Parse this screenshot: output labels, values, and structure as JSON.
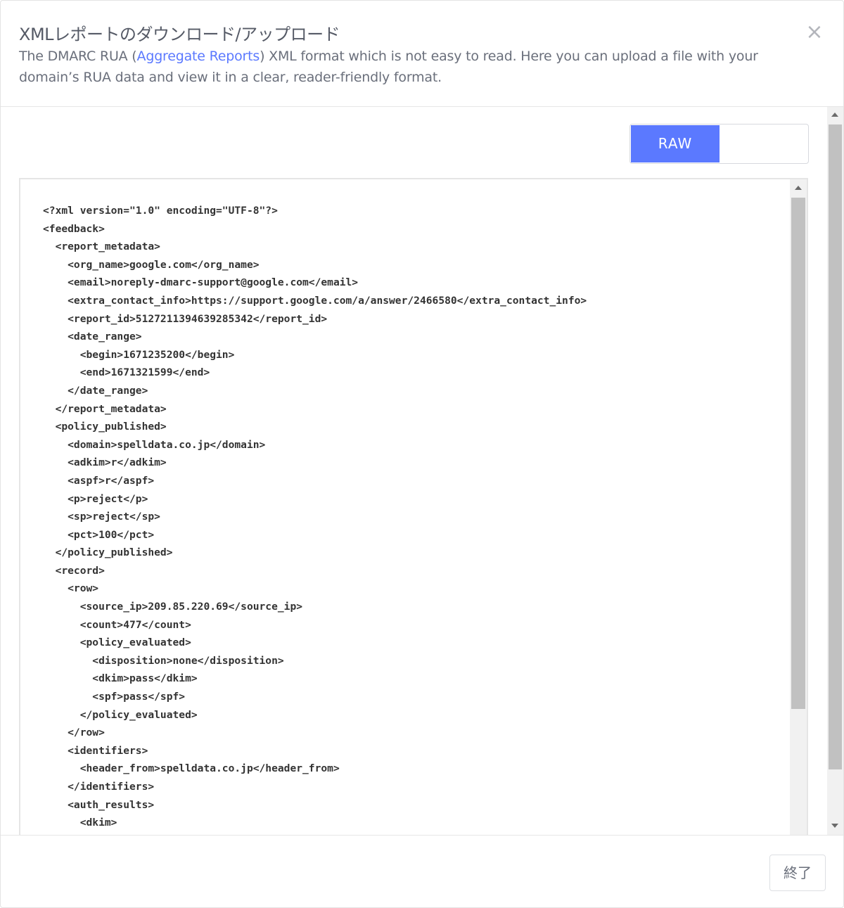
{
  "modal": {
    "title": "XMLレポートのダウンロード/アップロード",
    "close_symbol": "×",
    "description": {
      "before": "The DMARC RUA (",
      "link": "Aggregate Reports",
      "after": ") XML format which is not easy to read. Here you can upload a file with your domain’s RUA data and view it in a clear, reader-friendly format."
    }
  },
  "toggle": {
    "raw_label": "RAW",
    "other_label": ""
  },
  "xml": {
    "lines": [
      "<?xml version=\"1.0\" encoding=\"UTF-8\"?>",
      "<feedback>",
      "  <report_metadata>",
      "    <org_name>google.com</org_name>",
      "    <email>noreply-dmarc-support@google.com</email>",
      "    <extra_contact_info>https://support.google.com/a/answer/2466580</extra_contact_info>",
      "    <report_id>5127211394639285342</report_id>",
      "    <date_range>",
      "      <begin>1671235200</begin>",
      "      <end>1671321599</end>",
      "    </date_range>",
      "  </report_metadata>",
      "  <policy_published>",
      "    <domain>spelldata.co.jp</domain>",
      "    <adkim>r</adkim>",
      "    <aspf>r</aspf>",
      "    <p>reject</p>",
      "    <sp>reject</sp>",
      "    <pct>100</pct>",
      "  </policy_published>",
      "  <record>",
      "    <row>",
      "      <source_ip>209.85.220.69</source_ip>",
      "      <count>477</count>",
      "      <policy_evaluated>",
      "        <disposition>none</disposition>",
      "        <dkim>pass</dkim>",
      "        <spf>pass</spf>",
      "      </policy_evaluated>",
      "    </row>",
      "    <identifiers>",
      "      <header_from>spelldata.co.jp</header_from>",
      "    </identifiers>",
      "    <auth_results>",
      "      <dkim>"
    ]
  },
  "footer": {
    "close_label": "終了"
  },
  "colors": {
    "accent": "#5b79ff",
    "text": "#555a66",
    "code_text": "#333333"
  }
}
